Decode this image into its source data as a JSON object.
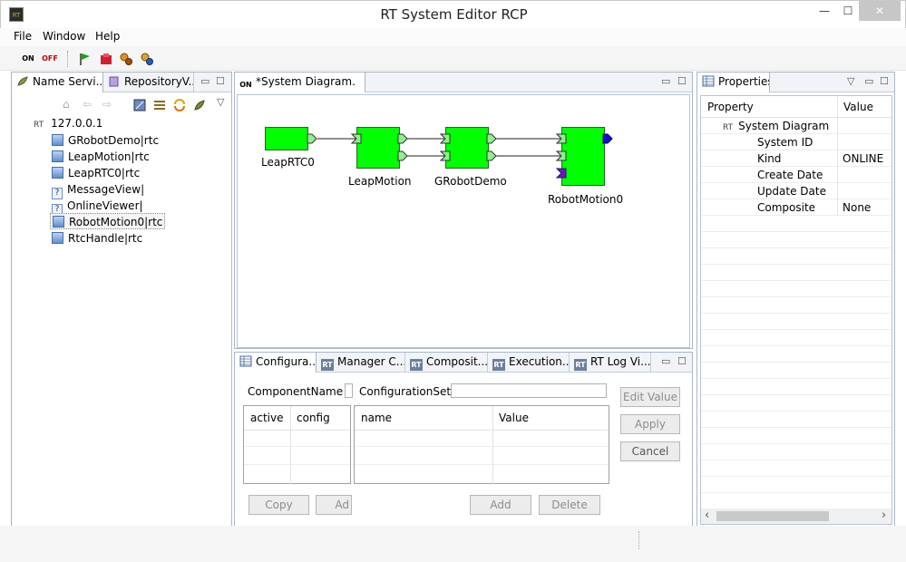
{
  "window": {
    "title": "RT System Editor RCP",
    "icon_text": "RT",
    "minimize_glyph": "—",
    "maximize_glyph": "☐",
    "close_glyph": "✕"
  },
  "menu": [
    "File",
    "Window",
    "Help"
  ],
  "toolbar": {
    "on_label": "ON",
    "off_label": "OFF"
  },
  "name_service": {
    "tabs": [
      {
        "label": "Name Servi..."
      },
      {
        "label": "RepositoryV..."
      }
    ],
    "host": {
      "prefix": "RT",
      "label": "127.0.0.1"
    },
    "items": [
      {
        "label": "GRobotDemo|rtc",
        "icon": "component-icon"
      },
      {
        "label": "LeapMotion|rtc",
        "icon": "component-icon"
      },
      {
        "label": "LeapRTC0|rtc",
        "icon": "component-icon"
      },
      {
        "label": "MessageView|",
        "icon": "unknown-icon",
        "glyph": "?"
      },
      {
        "label": "OnlineViewer|",
        "icon": "unknown-icon",
        "glyph": "?"
      },
      {
        "label": "RobotMotion0|rtc",
        "icon": "component-icon"
      },
      {
        "label": "RtcHandle|rtc",
        "icon": "component-icon"
      }
    ]
  },
  "diagram": {
    "tab_label": "*System Diagram.",
    "tab_icon_text": "ON",
    "close_glyph": "⊠",
    "components": [
      {
        "name": "LeapRTC0"
      },
      {
        "name": "LeapMotion"
      },
      {
        "name": "GRobotDemo"
      },
      {
        "name": "RobotMotion0"
      }
    ]
  },
  "bottom": {
    "tabs": [
      {
        "label": "Configura..."
      },
      {
        "label": "Manager C..."
      },
      {
        "label": "Composit..."
      },
      {
        "label": "Execution..."
      },
      {
        "label": "RT Log Vi..."
      }
    ],
    "tab_icon_text": "RT",
    "component_name_label": "ComponentName :",
    "configuration_set_label": "ConfigurationSet :",
    "left_table_headers": [
      "active",
      "config"
    ],
    "right_table_headers": [
      "name",
      "Value"
    ],
    "buttons": {
      "edit_value": "Edit Value",
      "apply": "Apply",
      "cancel": "Cancel",
      "copy": "Copy",
      "add_left": "Ad",
      "add": "Add",
      "delete": "Delete"
    }
  },
  "properties": {
    "tab_label": "Properties",
    "headers": [
      "Property",
      "Value"
    ],
    "root": {
      "prefix": "RT",
      "label": "System Diagram"
    },
    "rows": [
      {
        "property": "System ID",
        "value": ""
      },
      {
        "property": "Kind",
        "value": "ONLINE"
      },
      {
        "property": "Create Date",
        "value": ""
      },
      {
        "property": "Update Date",
        "value": ""
      },
      {
        "property": "Composite",
        "value": "None"
      }
    ],
    "scroll_left_glyph": "‹",
    "scroll_right_glyph": "›"
  }
}
